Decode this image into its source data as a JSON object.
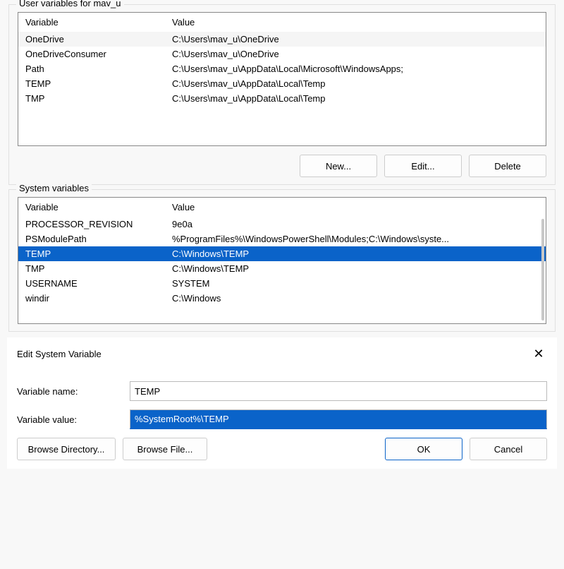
{
  "user_section": {
    "title": "User variables for mav_u",
    "columns": {
      "variable": "Variable",
      "value": "Value"
    },
    "rows": [
      {
        "variable": "OneDrive",
        "value": "C:\\Users\\mav_u\\OneDrive"
      },
      {
        "variable": "OneDriveConsumer",
        "value": "C:\\Users\\mav_u\\OneDrive"
      },
      {
        "variable": "Path",
        "value": "C:\\Users\\mav_u\\AppData\\Local\\Microsoft\\WindowsApps;"
      },
      {
        "variable": "TEMP",
        "value": "C:\\Users\\mav_u\\AppData\\Local\\Temp"
      },
      {
        "variable": "TMP",
        "value": "C:\\Users\\mav_u\\AppData\\Local\\Temp"
      }
    ],
    "buttons": {
      "new": "New...",
      "edit": "Edit...",
      "delete": "Delete"
    }
  },
  "system_section": {
    "title": "System variables",
    "columns": {
      "variable": "Variable",
      "value": "Value"
    },
    "rows": [
      {
        "variable": "PROCESSOR_REVISION",
        "value": "9e0a"
      },
      {
        "variable": "PSModulePath",
        "value": "%ProgramFiles%\\WindowsPowerShell\\Modules;C:\\Windows\\syste..."
      },
      {
        "variable": "TEMP",
        "value": "C:\\Windows\\TEMP",
        "selected": true
      },
      {
        "variable": "TMP",
        "value": "C:\\Windows\\TEMP"
      },
      {
        "variable": "USERNAME",
        "value": "SYSTEM"
      },
      {
        "variable": "windir",
        "value": "C:\\Windows"
      }
    ]
  },
  "edit_dialog": {
    "title": "Edit System Variable",
    "name_label": "Variable name:",
    "name_value": "TEMP",
    "value_label": "Variable value:",
    "value_value": "%SystemRoot%\\TEMP",
    "buttons": {
      "browse_dir": "Browse Directory...",
      "browse_file": "Browse File...",
      "ok": "OK",
      "cancel": "Cancel"
    }
  }
}
